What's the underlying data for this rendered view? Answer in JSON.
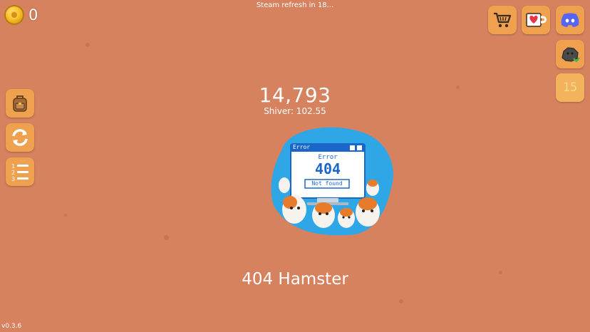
{
  "currency": {
    "count": "0",
    "icon": "coin-icon"
  },
  "steam_message": "Steam refresh in 18...",
  "score": {
    "value": "14,793",
    "shiver_text": "Shiver: 102.55"
  },
  "pet": {
    "name": "404 Hamster",
    "window_title": "Error",
    "error_label": "Error",
    "error_code": "404",
    "error_button": "Not found"
  },
  "right_menu": {
    "shop_icon": "cart-icon",
    "support_icon": "heart-mug-icon",
    "discord_icon": "discord-icon",
    "rock_icon": "rock-icon",
    "level_badge": "15"
  },
  "left_menu": {
    "inventory_icon": "backpack-icon",
    "refresh_icon": "refresh-icon",
    "list_icon": "numbered-list-icon"
  },
  "version": "v0.3.6",
  "colors": {
    "background": "#d6825f",
    "button": "#f0a150",
    "accent_blue": "#1c66c9"
  }
}
